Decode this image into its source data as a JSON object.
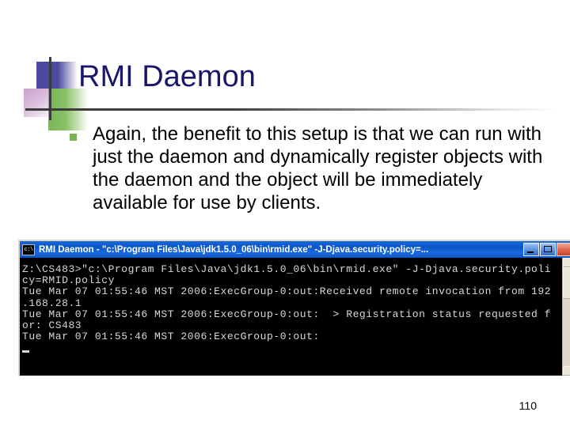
{
  "slide": {
    "title": "RMI Daemon",
    "bullet_text": "Again, the benefit to this setup is that we can run with just the daemon and dynamically register objects with the daemon and the object will be immediately available for use by clients.",
    "page_number": "110"
  },
  "console": {
    "icon_label": "c:\\",
    "title": "RMI Daemon - \"c:\\Program Files\\Java\\jdk1.5.0_06\\bin\\rmid.exe\" -J-Djava.security.policy=...",
    "window_buttons": {
      "minimize": "Minimize",
      "maximize": "Maximize",
      "close": "Close"
    },
    "lines": [
      "Z:\\CS483>\"c:\\Program Files\\Java\\jdk1.5.0_06\\bin\\rmid.exe\" -J-Djava.security.poli",
      "cy=RMID.policy",
      "Tue Mar 07 01:55:46 MST 2006:ExecGroup-0:out:Received remote invocation from 192",
      ".168.28.1",
      "Tue Mar 07 01:55:46 MST 2006:ExecGroup-0:out:  > Registration status requested f",
      "or: CS483",
      "Tue Mar 07 01:55:46 MST 2006:ExecGroup-0:out:"
    ]
  },
  "colors": {
    "title_text": "#17176b",
    "bullet_marker": "#77b255",
    "deco_blue": "#4a4a9e",
    "deco_pink": "#caa0cc",
    "deco_green": "#79b755",
    "titlebar_blue": "#0a56c8",
    "console_bg": "#000000",
    "console_text": "#d8d8d8"
  }
}
